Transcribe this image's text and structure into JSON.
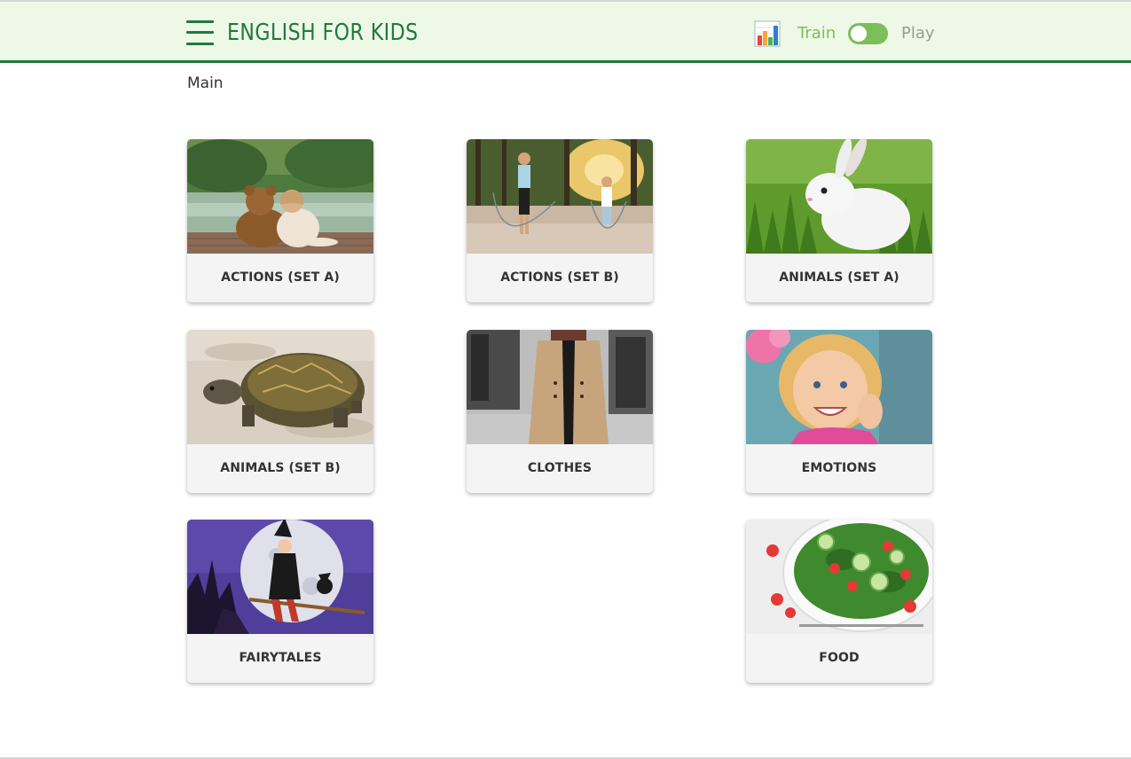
{
  "header": {
    "title": "ENGLISH FOR KIDS",
    "menu_icon": "hamburger-icon",
    "stats_icon": "bar-chart-icon",
    "mode_train_label": "Train",
    "mode_play_label": "Play",
    "mode_toggle_on": true
  },
  "breadcrumb": "Main",
  "colors": {
    "brand": "#1f7a3a",
    "header_bg": "#eef8e6",
    "accent": "#7cbe57",
    "card_label_bg": "#f4f4f4"
  },
  "categories": [
    {
      "label": "ACTIONS (SET A)",
      "image": "teddy-bear-and-child-by-lake"
    },
    {
      "label": "ACTIONS (SET B)",
      "image": "jumping-rope-in-park"
    },
    {
      "label": "ANIMALS (SET A)",
      "image": "white-rabbit-in-grass"
    },
    {
      "label": "ANIMALS (SET B)",
      "image": "tortoise-on-sand"
    },
    {
      "label": "CLOTHES",
      "image": "woman-in-beige-coat"
    },
    {
      "label": "EMOTIONS",
      "image": "smiling-girl"
    },
    {
      "label": "FAIRYTALES",
      "image": "witch-on-broom-full-moon"
    },
    {
      "label": "FOOD",
      "image": "salad-bowl-with-tomatoes"
    }
  ]
}
